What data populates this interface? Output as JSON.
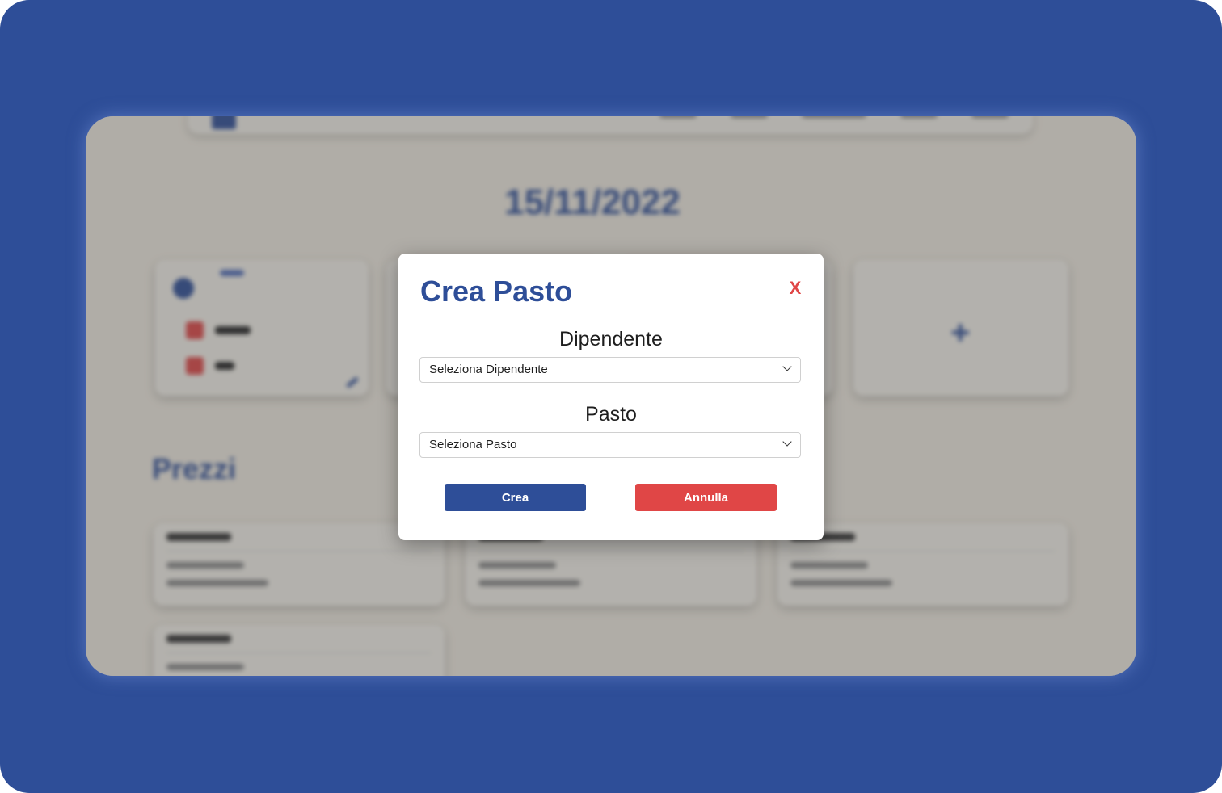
{
  "background_app": {
    "date": "15/11/2022",
    "section_title": "Prezzi",
    "add_card_symbol": "+"
  },
  "modal": {
    "title": "Crea Pasto",
    "close_label": "X",
    "employee_field": {
      "label": "Dipendente",
      "selected": "Seleziona Dipendente"
    },
    "meal_field": {
      "label": "Pasto",
      "selected": "Seleziona Pasto"
    },
    "create_label": "Crea",
    "cancel_label": "Annulla"
  },
  "colors": {
    "frame": "#2e4e98",
    "primary": "#2e4e98",
    "danger": "#e04646",
    "app_background": "#f1ece2"
  },
  "icons": {
    "close": "close-icon",
    "dropdown": "chevron-down-icon",
    "add": "plus-icon"
  }
}
